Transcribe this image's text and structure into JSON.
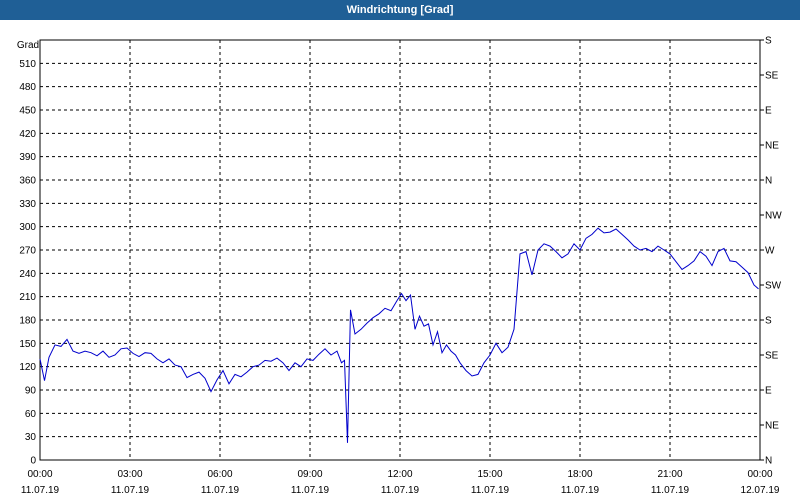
{
  "window": {
    "title": "Windrichtung [Grad]"
  },
  "chart_data": {
    "type": "line",
    "title": "Windrichtung [Grad]",
    "ylabel": "Grad",
    "ylim": [
      0,
      540
    ],
    "y_ticks": [
      0,
      30,
      60,
      90,
      120,
      150,
      180,
      210,
      240,
      270,
      300,
      330,
      360,
      390,
      420,
      450,
      480,
      510
    ],
    "y2_ticks": [
      {
        "value": 0,
        "label": "N"
      },
      {
        "value": 45,
        "label": "NE"
      },
      {
        "value": 90,
        "label": "E"
      },
      {
        "value": 135,
        "label": "SE"
      },
      {
        "value": 180,
        "label": "S"
      },
      {
        "value": 225,
        "label": "SW"
      },
      {
        "value": 270,
        "label": "W"
      },
      {
        "value": 315,
        "label": "NW"
      },
      {
        "value": 360,
        "label": "N"
      },
      {
        "value": 405,
        "label": "NE"
      },
      {
        "value": 450,
        "label": "E"
      },
      {
        "value": 495,
        "label": "SE"
      },
      {
        "value": 540,
        "label": "S"
      }
    ],
    "xlim": [
      0,
      24
    ],
    "x_ticks": [
      {
        "value": 0,
        "time": "00:00",
        "date": "11.07.19"
      },
      {
        "value": 3,
        "time": "03:00",
        "date": "11.07.19"
      },
      {
        "value": 6,
        "time": "06:00",
        "date": "11.07.19"
      },
      {
        "value": 9,
        "time": "09:00",
        "date": "11.07.19"
      },
      {
        "value": 12,
        "time": "12:00",
        "date": "11.07.19"
      },
      {
        "value": 15,
        "time": "15:00",
        "date": "11.07.19"
      },
      {
        "value": 18,
        "time": "18:00",
        "date": "11.07.19"
      },
      {
        "value": 21,
        "time": "21:00",
        "date": "11.07.19"
      },
      {
        "value": 24,
        "time": "00:00",
        "date": "12.07.19"
      }
    ],
    "grid": true,
    "colors": {
      "line": "#0000cc",
      "grid": "#000000",
      "title_bar": "#1f5f96"
    },
    "series": [
      {
        "x": [
          0,
          0.15,
          0.3,
          0.5,
          0.7,
          0.9,
          1.1,
          1.3,
          1.5,
          1.7,
          1.9,
          2.1,
          2.3,
          2.5,
          2.7,
          2.9,
          3.1,
          3.3,
          3.5,
          3.7,
          3.9,
          4.1,
          4.3,
          4.5,
          4.7,
          4.9,
          5.1,
          5.3,
          5.5,
          5.7,
          5.9,
          6.1,
          6.3,
          6.5,
          6.7,
          6.9,
          7.1,
          7.3,
          7.5,
          7.7,
          7.9,
          8.1,
          8.3,
          8.5,
          8.7,
          8.9,
          9.1,
          9.3,
          9.5,
          9.7,
          9.9,
          10.05,
          10.15,
          10.25,
          10.35,
          10.5,
          10.7,
          10.9,
          11.1,
          11.3,
          11.5,
          11.7,
          11.9,
          12.05,
          12.2,
          12.35,
          12.5,
          12.65,
          12.8,
          12.95,
          13.1,
          13.25,
          13.4,
          13.55,
          13.7,
          13.85,
          14.0,
          14.2,
          14.4,
          14.6,
          14.8,
          15.0,
          15.2,
          15.4,
          15.6,
          15.8,
          16.0,
          16.2,
          16.4,
          16.6,
          16.8,
          17.0,
          17.2,
          17.4,
          17.6,
          17.8,
          18.0,
          18.2,
          18.4,
          18.6,
          18.8,
          19.0,
          19.2,
          19.4,
          19.6,
          19.8,
          20.0,
          20.2,
          20.4,
          20.6,
          20.8,
          21.0,
          21.2,
          21.4,
          21.6,
          21.8,
          22.0,
          22.2,
          22.4,
          22.6,
          22.8,
          23.0,
          23.2,
          23.4,
          23.6,
          23.8,
          23.95
        ],
        "values": [
          130,
          102,
          132,
          148,
          146,
          155,
          140,
          137,
          140,
          138,
          134,
          140,
          132,
          135,
          143,
          144,
          137,
          133,
          138,
          137,
          130,
          125,
          130,
          122,
          120,
          106,
          110,
          113,
          105,
          88,
          103,
          115,
          98,
          110,
          107,
          113,
          120,
          122,
          128,
          127,
          131,
          125,
          115,
          125,
          120,
          130,
          128,
          136,
          143,
          135,
          140,
          125,
          128,
          22,
          193,
          162,
          168,
          176,
          183,
          188,
          195,
          192,
          205,
          214,
          205,
          212,
          168,
          185,
          172,
          175,
          148,
          165,
          138,
          148,
          140,
          135,
          125,
          115,
          108,
          110,
          125,
          135,
          150,
          138,
          145,
          168,
          265,
          268,
          238,
          270,
          278,
          275,
          268,
          260,
          265,
          278,
          270,
          285,
          290,
          298,
          292,
          293,
          297,
          290,
          283,
          275,
          270,
          272,
          268,
          275,
          270,
          265,
          255,
          245,
          250,
          256,
          268,
          262,
          250,
          268,
          272,
          256,
          255,
          248,
          241,
          225,
          220
        ]
      }
    ]
  }
}
